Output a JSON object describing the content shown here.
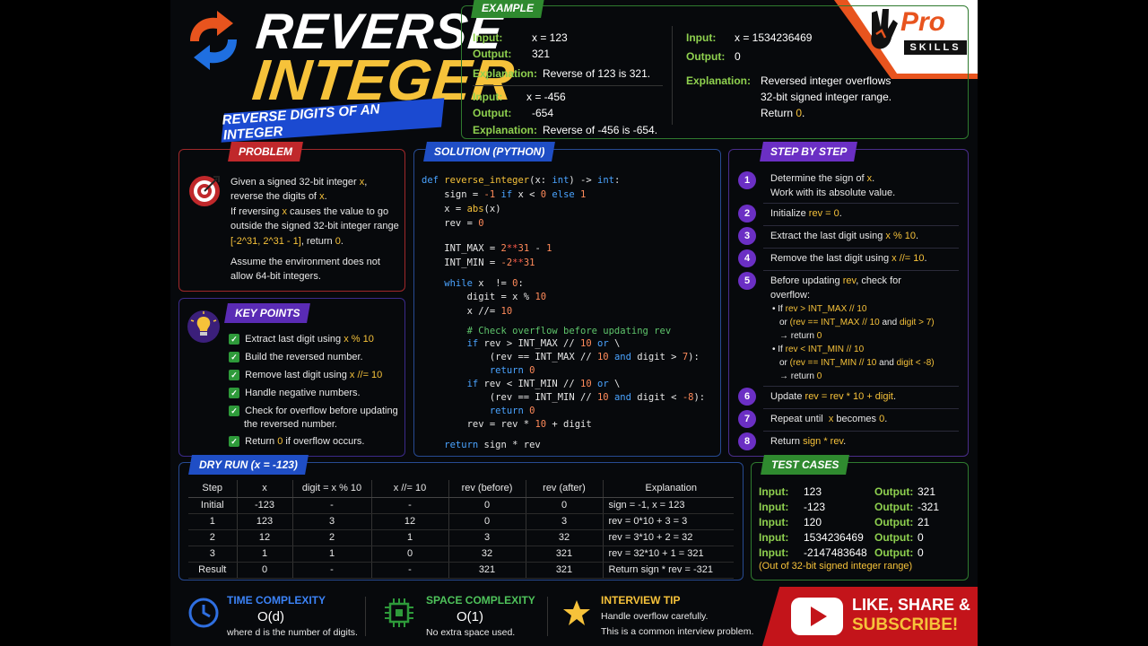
{
  "header": {
    "title_line1": "REVERSE",
    "title_line2": "INTEGER",
    "subtitle": "REVERSE DIGITS OF AN INTEGER",
    "brand_pro": "Pro",
    "brand_skills": "SKILLS"
  },
  "example": {
    "tag": "EXAMPLE",
    "input_label": "Input:",
    "output_label": "Output:",
    "explanation_label": "Explanation:",
    "ex1_input": "x = 123",
    "ex1_output": "321",
    "ex1_explanation": "Reverse of 123 is 321.",
    "ex2_input": "x = -456",
    "ex2_output": "-654",
    "ex2_explanation": "Reverse of -456 is -654.",
    "ex3_input": "x = 1534236469",
    "ex3_output": "0",
    "ex3_expl_l1": "Reversed integer overflows",
    "ex3_expl_l2": "32-bit signed integer range.",
    "ex3_expl_l3a": "Return ",
    "ex3_expl_l3b": "0",
    "ex3_expl_l3c": "."
  },
  "problem": {
    "tag": "PROBLEM",
    "l1a": "Given a signed 32-bit integer ",
    "l1b": "x",
    "l1c": ",",
    "l2a": "reverse the digits of ",
    "l2b": "x",
    "l2c": ".",
    "l3a": "If reversing ",
    "l3b": "x",
    "l3c": " causes the value to go",
    "l4": "outside the signed 32-bit integer range",
    "l5a": "[-2^31, 2^31 - 1]",
    "l5b": ", return ",
    "l5c": "0",
    "l5d": ".",
    "l6": "Assume the environment does not",
    "l7": "allow 64-bit integers."
  },
  "keypoints": {
    "tag": "KEY POINTS",
    "items": [
      {
        "text": "Extract last digit using ",
        "code": "x % 10",
        "rest": ""
      },
      {
        "text": "Build the reversed number.",
        "code": "",
        "rest": ""
      },
      {
        "text": "Remove last digit using ",
        "code": "x //= 10",
        "rest": ""
      },
      {
        "text": "Handle negative numbers.",
        "code": "",
        "rest": ""
      },
      {
        "text": "Check for overflow before updating",
        "code": "",
        "rest": "the reversed number."
      },
      {
        "text": "Return ",
        "code": "0",
        "rest": " if overflow occurs."
      }
    ]
  },
  "solution": {
    "tag": "SOLUTION (PYTHON)",
    "def_kw": "def",
    "fn_name": "reverse_integer",
    "sig_a": "(x: ",
    "sig_int": "int",
    "sig_b": ") -> ",
    "sig_int2": "int",
    "sig_c": ":",
    "l_sign_a": "    sign = ",
    "l_sign_n1": "-1",
    "l_sign_if": " if",
    "l_sign_b": " x < ",
    "l_sign_n0": "0",
    "l_sign_else": " else",
    "l_sign_n2": " 1",
    "l_abs_a": "    x = ",
    "l_abs_fn": "abs",
    "l_abs_b": "(x)",
    "l_rev_a": "    rev = ",
    "l_rev_n": "0",
    "l_max_a": "    INT_MAX = ",
    "l_max_n1": "2",
    "l_max_op": "**",
    "l_max_n2": "31",
    "l_max_b": " - ",
    "l_max_n3": "1",
    "l_min_a": "    INT_MIN = ",
    "l_min_n1": "-2",
    "l_min_op": "**",
    "l_min_n2": "31",
    "l_while_kw": "    while",
    "l_while_a": " x  != ",
    "l_while_n": "0",
    "l_while_b": ":",
    "l_digit_a": "        digit = x % ",
    "l_digit_n": "10",
    "l_xdiv_a": "        x //= ",
    "l_xdiv_n": "10",
    "l_comment": "        # Check overflow before updating rev",
    "l_if1_kw": "        if",
    "l_if1_a": " rev > INT_MAX // ",
    "l_if1_n": "10",
    "l_if1_or": " or",
    "l_if1_b": " \\",
    "l_if1c_a": "            (rev == INT_MAX // ",
    "l_if1c_n1": "10",
    "l_if1c_and": " and",
    "l_if1c_b": " digit > ",
    "l_if1c_n2": "7",
    "l_if1c_c": "):",
    "l_ret1_kw": "            return",
    "l_ret1_n": " 0",
    "l_if2_kw": "        if",
    "l_if2_a": " rev < INT_MIN // ",
    "l_if2_n": "10",
    "l_if2_or": " or",
    "l_if2_b": " \\",
    "l_if2c_a": "            (rev == INT_MIN // ",
    "l_if2c_n1": "10",
    "l_if2c_and": " and",
    "l_if2c_b": " digit < ",
    "l_if2c_n2": "-8",
    "l_if2c_c": "):",
    "l_ret2_kw": "            return",
    "l_ret2_n": " 0",
    "l_upd_a": "        rev = rev * ",
    "l_upd_n": "10",
    "l_upd_b": " + digit",
    "l_final_kw": "    return",
    "l_final_a": " sign * rev"
  },
  "steps": {
    "tag": "STEP BY STEP",
    "s1a": "Determine the sign of ",
    "s1b": "x",
    "s1c": ".",
    "s1d": "Work with its absolute value.",
    "s2a": "Initialize ",
    "s2b": "rev = 0",
    "s2c": ".",
    "s3a": "Extract the last digit using ",
    "s3b": "x % 10",
    "s3c": ".",
    "s4a": "Remove the last digit using ",
    "s4b": "x //= 10",
    "s4c": ".",
    "s5a": "Before updating ",
    "s5b": "rev",
    "s5c": ", check for",
    "s5d": "overflow:",
    "s5e1": "• If ",
    "s5e2": "rev > INT_MAX // 10",
    "s5f1": "or ",
    "s5f2": "(rev == INT_MAX // 10",
    "s5f3": " and ",
    "s5f4": "digit > 7)",
    "s5g1": "→ return ",
    "s5g2": "0",
    "s5h1": "• If ",
    "s5h2": "rev < INT_MIN // 10",
    "s5i1": "or ",
    "s5i2": "(rev == INT_MIN // 10",
    "s5i3": " and ",
    "s5i4": "digit < -8)",
    "s5j1": "→ return ",
    "s5j2": "0",
    "s6a": "Update ",
    "s6b": "rev = rev * 10 + digit",
    "s6c": ".",
    "s7a": "Repeat until  ",
    "s7b": "x",
    "s7c": " becomes ",
    "s7d": "0",
    "s7e": ".",
    "s8a": "Return ",
    "s8b": "sign * rev",
    "s8c": "."
  },
  "dryrun": {
    "tag": "DRY RUN (x = -123)",
    "headers": [
      "Step",
      "x",
      "digit = x % 10",
      "x //= 10",
      "rev (before)",
      "rev (after)",
      "Explanation"
    ],
    "rows": [
      [
        "Initial",
        "-123",
        "-",
        "-",
        "0",
        "0",
        "sign = -1, x = 123"
      ],
      [
        "1",
        "123",
        "3",
        "12",
        "0",
        "3",
        "rev = 0*10 + 3 = 3"
      ],
      [
        "2",
        "12",
        "2",
        "1",
        "3",
        "32",
        "rev = 3*10 + 2 = 32"
      ],
      [
        "3",
        "1",
        "1",
        "0",
        "32",
        "321",
        "rev = 32*10 + 1 = 321"
      ],
      [
        "Result",
        "0",
        "-",
        "-",
        "321",
        "321",
        "Return sign * rev = -321"
      ]
    ]
  },
  "testcases": {
    "tag": "TEST CASES",
    "input_label": "Input:",
    "output_label": "Output:",
    "rows": [
      {
        "input": "123",
        "output": "321"
      },
      {
        "input": "-123",
        "output": "-321"
      },
      {
        "input": "120",
        "output": "21"
      },
      {
        "input": "1534236469",
        "output": "0"
      },
      {
        "input": "-2147483648",
        "output": "0"
      }
    ],
    "note": "(Out of 32-bit signed integer range)"
  },
  "bottom": {
    "time_title": "TIME COMPLEXITY",
    "time_value": "O(d)",
    "time_sub": "where d is the number of digits.",
    "space_title": "SPACE COMPLEXITY",
    "space_value": "O(1)",
    "space_sub": "No extra space used.",
    "tip_title": "INTERVIEW TIP",
    "tip_l1": "Handle overflow carefully.",
    "tip_l2": "This is a common interview problem."
  },
  "subscribe": {
    "line1": "LIKE, SHARE &",
    "line2": "SUBSCRIBE!"
  },
  "icons": {
    "arrows": "refresh-arrows-icon",
    "target": "target-icon",
    "bulb": "lightbulb-icon",
    "clock": "clock-icon",
    "chip": "chip-icon",
    "star": "star-icon",
    "youtube": "youtube-play-icon"
  },
  "colors": {
    "accent_yellow": "#f6c23a",
    "accent_green": "#8fd14f",
    "accent_red": "#c3141a",
    "accent_blue": "#1f4ec5",
    "accent_purple": "#6b2fc4",
    "brand_orange": "#e8541e"
  }
}
